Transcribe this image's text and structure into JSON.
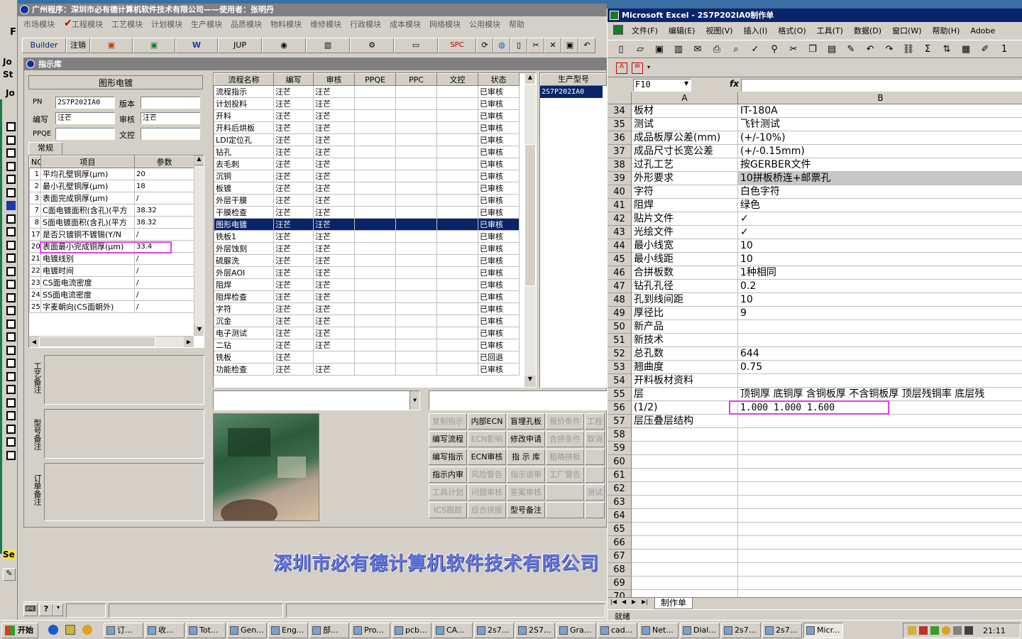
{
  "main_app": {
    "title": "广州程序：深圳市必有德计算机软件技术有限公司——使用者：张明丹",
    "menu": [
      "市场模块",
      "工程模块",
      "工艺模块",
      "计划模块",
      "生产模块",
      "品质模块",
      "物料模块",
      "维修模块",
      "行政模块",
      "成本模块",
      "网络模块",
      "公用模块",
      "帮助"
    ],
    "toolbar": [
      "Builder",
      "注销",
      "",
      "",
      "",
      "JUP",
      "",
      "",
      "",
      "",
      "SPC"
    ],
    "left_strip_labels": [
      "F",
      "Jo",
      "St",
      "Jo",
      "Se"
    ]
  },
  "instruction_lib": {
    "title": "指示库",
    "process_name": "图形电镀",
    "fields": {
      "pn_label": "PN",
      "pn_value": "2S7P202IA0",
      "version_label": "版本",
      "version_value": "",
      "writer_label": "编写",
      "writer_value": "汪芒",
      "reviewer_label": "审核",
      "reviewer_value": "汪芒",
      "ppqe_label": "PPQE",
      "ppqe_value": "",
      "doc_label": "文控",
      "doc_value": ""
    },
    "tab": "常规",
    "param_headers": [
      "NO",
      "项目",
      "参数"
    ],
    "params": [
      {
        "no": "1",
        "item": "平均孔壁铜厚(μm)",
        "val": "20"
      },
      {
        "no": "2",
        "item": "最小孔壁铜厚(μm)",
        "val": "18"
      },
      {
        "no": "3",
        "item": "表面完成铜厚(μm)",
        "val": "/"
      },
      {
        "no": "7",
        "item": "C面电镀面积(含孔)(平方",
        "val": "38.32"
      },
      {
        "no": "8",
        "item": "S面电镀面积(含孔)(平方",
        "val": "38.32"
      },
      {
        "no": "17",
        "item": "是否只镀铜不镀锡(Y/N",
        "val": "/"
      },
      {
        "no": "20",
        "item": "表面最小完成铜厚(μm)",
        "val": "33.4"
      },
      {
        "no": "21",
        "item": "电镀线别",
        "val": "/"
      },
      {
        "no": "22",
        "item": "电镀时间",
        "val": "/"
      },
      {
        "no": "23",
        "item": "CS面电流密度",
        "val": "/"
      },
      {
        "no": "24",
        "item": "SS面电流密度",
        "val": "/"
      },
      {
        "no": "25",
        "item": "字麦朝向(CS面朝外)",
        "val": "/"
      }
    ],
    "notes": [
      "工艺备注",
      "型号备注",
      "订单备注"
    ],
    "flow_headers": [
      "流程名称",
      "编写",
      "审核",
      "PPQE",
      "PPC",
      "文控",
      "状态"
    ],
    "flows": [
      {
        "name": "流程指示",
        "w": "汪芒",
        "r": "汪芒",
        "s": "已审核"
      },
      {
        "name": "计划投料",
        "w": "汪芒",
        "r": "汪芒",
        "s": "已审核"
      },
      {
        "name": "开料",
        "w": "汪芒",
        "r": "汪芒",
        "s": "已审核"
      },
      {
        "name": "开料后烘板",
        "w": "汪芒",
        "r": "汪芒",
        "s": "已审核"
      },
      {
        "name": "LDI定位孔",
        "w": "汪芒",
        "r": "汪芒",
        "s": "已审核"
      },
      {
        "name": "钻孔",
        "w": "汪芒",
        "r": "汪芒",
        "s": "已审核"
      },
      {
        "name": "去毛刺",
        "w": "汪芒",
        "r": "汪芒",
        "s": "已审核"
      },
      {
        "name": "沉铜",
        "w": "汪芒",
        "r": "汪芒",
        "s": "已审核"
      },
      {
        "name": "板镀",
        "w": "汪芒",
        "r": "汪芒",
        "s": "已审核"
      },
      {
        "name": "外层干膜",
        "w": "汪芒",
        "r": "汪芒",
        "s": "已审核"
      },
      {
        "name": "干膜检查",
        "w": "汪芒",
        "r": "汪芒",
        "s": "已审核"
      },
      {
        "name": "图形电镀",
        "w": "汪芒",
        "r": "汪芒",
        "s": "已审核"
      },
      {
        "name": "铣板1",
        "w": "汪芒",
        "r": "汪芒",
        "s": "已审核"
      },
      {
        "name": "外层蚀刻",
        "w": "汪芒",
        "r": "汪芒",
        "s": "已审核"
      },
      {
        "name": "硫脲洗",
        "w": "汪芒",
        "r": "汪芒",
        "s": "已审核"
      },
      {
        "name": "外层AOI",
        "w": "汪芒",
        "r": "汪芒",
        "s": "已审核"
      },
      {
        "name": "阻焊",
        "w": "汪芒",
        "r": "汪芒",
        "s": "已审核"
      },
      {
        "name": "阻焊检查",
        "w": "汪芒",
        "r": "汪芒",
        "s": "已审核"
      },
      {
        "name": "字符",
        "w": "汪芒",
        "r": "汪芒",
        "s": "已审核"
      },
      {
        "name": "沉金",
        "w": "汪芒",
        "r": "汪芒",
        "s": "已审核"
      },
      {
        "name": "电子测试",
        "w": "汪芒",
        "r": "汪芒",
        "s": "已审核"
      },
      {
        "name": "二钻",
        "w": "汪芒",
        "r": "汪芒",
        "s": "已审核"
      },
      {
        "name": "铣板",
        "w": "汪芒",
        "r": "",
        "s": "已回退"
      },
      {
        "name": "功能检查",
        "w": "汪芒",
        "r": "汪芒",
        "s": "已审核"
      }
    ],
    "model_header": "生产型号",
    "model_value": "2S7P202IA0",
    "actions": [
      [
        "复制指示",
        "内部ECN",
        "盲埋孔板",
        "报价条件",
        "工程"
      ],
      [
        "编写流程",
        "ECN影响",
        "修改申请",
        "合拼条件",
        "取消"
      ],
      [
        "编写指示",
        "ECN审核",
        "指 示 库",
        "粗略拼板",
        ""
      ],
      [
        "指示内审",
        "风险警告",
        "指示退审",
        "工厂警告",
        ""
      ],
      [
        "工具计划",
        "问题审核",
        "答案审核",
        "",
        "测试"
      ],
      [
        "ICS跟踪",
        "组合拼版",
        "型号备注",
        "",
        ""
      ]
    ],
    "company_banner": "深圳市必有德计算机软件技术有限公司"
  },
  "excel": {
    "title": "Microsoft Excel - 2S7P202IA0制作单",
    "menu": [
      "文件(F)",
      "编辑(E)",
      "视图(V)",
      "插入(I)",
      "格式(O)",
      "工具(T)",
      "数据(D)",
      "窗口(W)",
      "帮助(H)",
      "Adobe"
    ],
    "namebox": "F10",
    "fx": "fx",
    "col_a": "A",
    "col_b": "B",
    "rows": [
      {
        "n": "34",
        "a": "板材",
        "b": "IT-180A"
      },
      {
        "n": "35",
        "a": "测试",
        "b": "飞针测试"
      },
      {
        "n": "36",
        "a": "成品板厚公差(mm)",
        "b": "(+/-10%)"
      },
      {
        "n": "37",
        "a": "成品尺寸长宽公差",
        "b": "(+/-0.15mm)"
      },
      {
        "n": "38",
        "a": "过孔工艺",
        "b": "按GERBER文件"
      },
      {
        "n": "39",
        "a": "外形要求",
        "b": "10拼板桥连+邮票孔"
      },
      {
        "n": "40",
        "a": "字符",
        "b": "白色字符"
      },
      {
        "n": "41",
        "a": "阻焊",
        "b": "绿色"
      },
      {
        "n": "42",
        "a": "贴片文件",
        "b": "✓"
      },
      {
        "n": "43",
        "a": "光绘文件",
        "b": "✓"
      },
      {
        "n": "44",
        "a": "最小线宽",
        "b": "10"
      },
      {
        "n": "45",
        "a": "最小线距",
        "b": "10"
      },
      {
        "n": "46",
        "a": "合拼板数",
        "b": "1种相同"
      },
      {
        "n": "47",
        "a": "钻孔孔径",
        "b": "0.2"
      },
      {
        "n": "48",
        "a": "孔到线间距",
        "b": "10"
      },
      {
        "n": "49",
        "a": "厚径比",
        "b": "9"
      },
      {
        "n": "50",
        "a": "新产品",
        "b": ""
      },
      {
        "n": "51",
        "a": "新技术",
        "b": ""
      },
      {
        "n": "52",
        "a": "总孔数",
        "b": "644"
      },
      {
        "n": "53",
        "a": "翘曲度",
        "b": "0.75"
      },
      {
        "n": "54",
        "a": "开料板材资料",
        "b": ""
      },
      {
        "n": "55",
        "a": "层",
        "b": "顶铜厚  底铜厚  含铜板厚  不含铜板厚  顶层残铜率  底层残"
      },
      {
        "n": "56",
        "a": "(1/2)",
        "b": "1.000   1.000   1.600"
      },
      {
        "n": "57",
        "a": "层压叠层结构",
        "b": ""
      },
      {
        "n": "58",
        "a": "",
        "b": ""
      },
      {
        "n": "59",
        "a": "",
        "b": ""
      },
      {
        "n": "60",
        "a": "",
        "b": ""
      },
      {
        "n": "61",
        "a": "",
        "b": ""
      },
      {
        "n": "62",
        "a": "",
        "b": ""
      },
      {
        "n": "63",
        "a": "",
        "b": ""
      },
      {
        "n": "64",
        "a": "",
        "b": ""
      },
      {
        "n": "65",
        "a": "",
        "b": ""
      },
      {
        "n": "66",
        "a": "",
        "b": ""
      },
      {
        "n": "67",
        "a": "",
        "b": ""
      },
      {
        "n": "68",
        "a": "",
        "b": ""
      },
      {
        "n": "69",
        "a": "",
        "b": ""
      },
      {
        "n": "70",
        "a": "",
        "b": ""
      }
    ],
    "sheet_tab": "制作单",
    "status": "就绪"
  },
  "taskbar": {
    "start": "开始",
    "items": [
      "订...",
      "收...",
      "Tot...",
      "Gen...",
      "Eng...",
      "部...",
      "Pro...",
      "pcb...",
      "CA...",
      "2s7...",
      "2S7...",
      "Gra...",
      "cad...",
      "Net...",
      "Dial...",
      "2s7...",
      "2s7...",
      "Micr..."
    ],
    "clock": "21:11"
  },
  "colors": {
    "title_active": "#0a246a",
    "title_inactive": "#808080",
    "highlight_box": "#e040e0",
    "selection": "#0a246a",
    "desktop": "#3a6ea5"
  }
}
